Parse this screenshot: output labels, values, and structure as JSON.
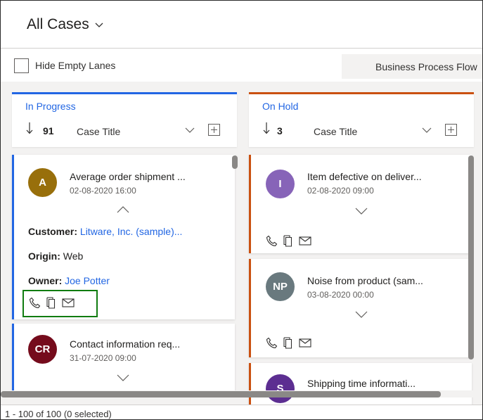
{
  "header": {
    "view_title": "All Cases"
  },
  "toolbar": {
    "hide_empty_lanes_label": "Hide Empty Lanes",
    "business_process_flow_label": "Business Process Flow"
  },
  "lanes": [
    {
      "name": "In Progress",
      "count": "91",
      "sort_field": "Case Title",
      "accent": "#2266e3",
      "cards": [
        {
          "initials": "A",
          "avatar_color": "#986f0b",
          "title": "Average order shipment ...",
          "date": "02-08-2020 16:00",
          "customer_label": "Customer:",
          "customer_value": "Litware, Inc. (sample)...",
          "origin_label": "Origin:",
          "origin_value": "Web",
          "owner_label": "Owner:",
          "owner_value": "Joe Potter",
          "expanded": true
        },
        {
          "initials": "CR",
          "avatar_color": "#750b1c",
          "title": "Contact information req...",
          "date": "31-07-2020 09:00"
        }
      ]
    },
    {
      "name": "On Hold",
      "count": "3",
      "sort_field": "Case Title",
      "accent": "#ca5010",
      "cards": [
        {
          "initials": "I",
          "avatar_color": "#8764b8",
          "title": "Item defective on deliver...",
          "date": "02-08-2020 09:00"
        },
        {
          "initials": "NP",
          "avatar_color": "#69797e",
          "title": "Noise from product (sam...",
          "date": "03-08-2020 00:00"
        },
        {
          "initials": "S",
          "avatar_color": "#5c2e91",
          "title": "Shipping time informati..."
        }
      ]
    }
  ],
  "footer": {
    "record_summary": "1 - 100 of 100 (0 selected)"
  },
  "icons": [
    "chevron-down-icon",
    "sort-down-arrow-icon",
    "add-icon",
    "phone-icon",
    "document-icon",
    "email-icon",
    "chevron-up-icon"
  ]
}
